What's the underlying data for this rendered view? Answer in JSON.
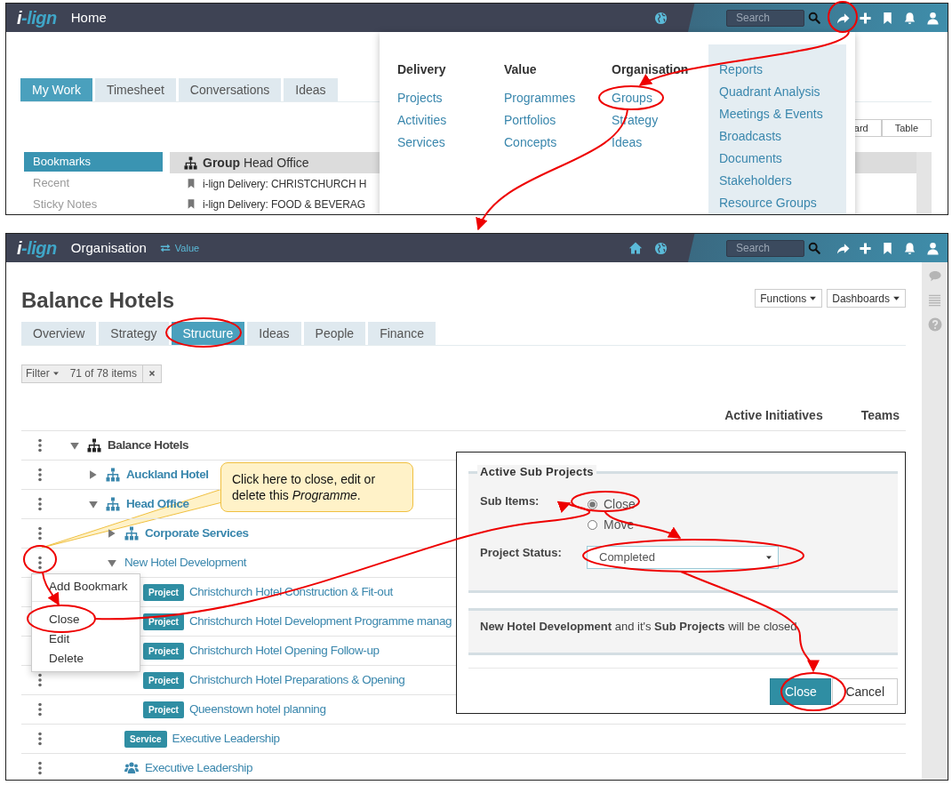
{
  "home_screen": {
    "navbar": {
      "logo": "i-lign",
      "title": "Home",
      "search": {
        "placeholder": "Search"
      }
    },
    "tabs": [
      {
        "label": "My Work",
        "selected": true
      },
      {
        "label": "Timesheet",
        "selected": false
      },
      {
        "label": "Conversations",
        "selected": false
      },
      {
        "label": "Ideas",
        "selected": false
      }
    ],
    "view_buttons": [
      "ard",
      "Table"
    ],
    "sidebar": {
      "items": [
        {
          "label": "Bookmarks",
          "selected": true
        },
        {
          "label": "Recent",
          "selected": false
        },
        {
          "label": "Sticky Notes",
          "selected": false
        }
      ]
    },
    "bookmarks": {
      "header": "**Group** Head Office",
      "items": [
        "i-lign Delivery: CHRISTCHURCH H",
        "i-lign Delivery: FOOD & BEVERAG"
      ]
    },
    "menu": {
      "columns": [
        {
          "heading": "Delivery",
          "items": [
            "Projects",
            "Activities",
            "Services"
          ]
        },
        {
          "heading": "Value",
          "items": [
            "Programmes",
            "Portfolios",
            "Concepts"
          ]
        },
        {
          "heading": "Organisation",
          "items": [
            "Groups",
            "Strategy",
            "Ideas"
          ]
        }
      ],
      "links": [
        "Reports",
        "Quadrant Analysis",
        "Meetings & Events",
        "Broadcasts",
        "Documents",
        "Stakeholders",
        "Resource Groups"
      ]
    }
  },
  "organisation_screen": {
    "navbar": {
      "logo": "i-lign",
      "title": "Organisation",
      "switch_label": "Value",
      "search": {
        "placeholder": "Search"
      }
    },
    "title": "Balance Hotels",
    "actions": [
      "Functions",
      "Dashboards"
    ],
    "tabs": [
      {
        "label": "Overview",
        "selected": false
      },
      {
        "label": "Strategy",
        "selected": false
      },
      {
        "label": "Structure",
        "selected": true
      },
      {
        "label": "Ideas",
        "selected": false
      },
      {
        "label": "People",
        "selected": false
      },
      {
        "label": "Finance",
        "selected": false
      }
    ],
    "filter": {
      "label": "Filter",
      "count": "71 of 78 items"
    },
    "columns": [
      "Active Initiatives",
      "Teams"
    ],
    "tree": [
      {
        "label": "Balance Hotels",
        "kind": "group",
        "expanded": true,
        "children": [
          {
            "label": "Auckland Hotel",
            "kind": "group",
            "expanded": false
          },
          {
            "label": "Head Office",
            "kind": "group",
            "expanded": true,
            "children": [
              {
                "label": "Corporate Services",
                "kind": "group",
                "expanded": false
              },
              {
                "label": "New Hotel Development",
                "kind": "programme",
                "expanded": true,
                "children": [
                  {
                    "label": "Christchurch Hotel Construction & Fit-out",
                    "kind": "project",
                    "badge": "Project"
                  },
                  {
                    "label": "Christchurch Hotel Development Programme manag",
                    "kind": "project",
                    "badge": "Project"
                  },
                  {
                    "label": "Christchurch Hotel Opening Follow-up",
                    "kind": "project",
                    "badge": "Project"
                  },
                  {
                    "label": "Christchurch Hotel Preparations & Opening",
                    "kind": "project",
                    "badge": "Project"
                  },
                  {
                    "label": "Queenstown hotel planning",
                    "kind": "project",
                    "badge": "Project"
                  }
                ]
              },
              {
                "label": "Executive Leadership",
                "kind": "service",
                "badge": "Service"
              },
              {
                "label": "Executive Leadership",
                "kind": "team"
              }
            ]
          }
        ]
      }
    ],
    "context_menu": {
      "items": [
        {
          "label": "Add Bookmark",
          "separator_after": true
        },
        {
          "label": "Close"
        },
        {
          "label": "Edit"
        },
        {
          "label": "Delete"
        }
      ]
    },
    "callout": {
      "text": "Click here to close, edit or delete this *Programme*."
    },
    "dialog": {
      "legend": "Active Sub Projects",
      "sub_items_label": "Sub Items:",
      "options": [
        {
          "label": "Close",
          "checked": true
        },
        {
          "label": "Move",
          "checked": false
        }
      ],
      "status_label": "Project Status:",
      "status_value": "Completed",
      "message": "**New Hotel Development** and it's **Sub Projects** will be closed.",
      "buttons": [
        {
          "label": "Close",
          "kind": "primary"
        },
        {
          "label": "Cancel",
          "kind": "secondary"
        }
      ]
    }
  }
}
